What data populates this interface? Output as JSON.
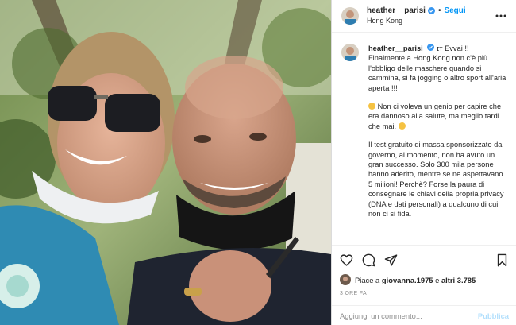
{
  "post": {
    "username": "heather__parisi",
    "follow_label": "Segui",
    "location": "Hong Kong",
    "photo_alt": "Selfie di Heather Parisi con un uomo calvo"
  },
  "caption": {
    "username": "heather__parisi",
    "paragraph1": "ɪᴛ Evvai !! Finalmente a Hong Kong non c'è più l'obbligo delle maschere quando si cammina, si fa jogging o altro sport all'aria aperta !!!",
    "paragraph2": "Non ci voleva un genio per capire che era dannoso alla salute, ma meglio tardi che mai.",
    "paragraph3": "Il test gratuito di massa sponsorizzato dal governo, al momento, non ha avuto un gran successo. Solo 300 mila persone hanno aderito, mentre se ne aspettavano 5 milioni! Perchè? Forse la paura di consegnare le chiavi della propria privacy (DNA e dati personali) a qualcuno di cui non ci si fida."
  },
  "likes": {
    "prefix": "Piace a",
    "user": "giovanna.1975",
    "middle": "e",
    "others": "altri 3.785"
  },
  "timestamp": "3 ORE FA",
  "comment": {
    "placeholder": "Aggiungi un commento...",
    "publish_label": "Pubblica"
  },
  "colors": {
    "accent": "#0095f6",
    "publish_disabled": "#b2dffc",
    "text": "#262626",
    "muted": "#8e8e8e"
  },
  "icons": [
    "verified-badge-icon",
    "more-options-icon",
    "heart-icon",
    "comment-icon",
    "share-icon",
    "bookmark-icon"
  ]
}
